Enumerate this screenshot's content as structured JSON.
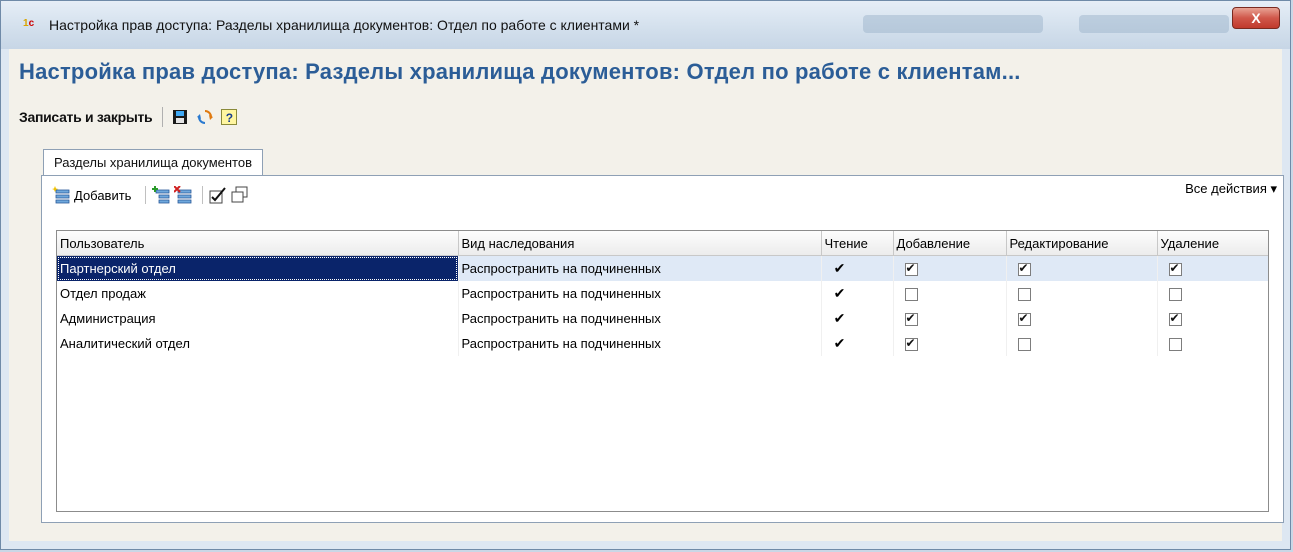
{
  "window": {
    "title": "Настройка прав доступа: Разделы хранилища документов: Отдел по работе с клиентами *",
    "close_label": "X"
  },
  "form": {
    "title": "Настройка прав доступа: Разделы хранилища документов: Отдел по работе с клиентам..."
  },
  "commandbar": {
    "save_close_label": "Записать и закрыть",
    "help_label": "?"
  },
  "tab": {
    "label": "Разделы хранилища документов"
  },
  "toolbar": {
    "add_label": "Добавить",
    "all_actions_label": "Все действия ▾"
  },
  "table": {
    "columns": [
      "Пользователь",
      "Вид наследования",
      "Чтение",
      "Добавление",
      "Редактирование",
      "Удаление"
    ],
    "rows": [
      {
        "user": "Партнерский отдел",
        "inheritance": "Распространить на подчиненных",
        "read": true,
        "add": true,
        "edit": true,
        "delete": true
      },
      {
        "user": "Отдел продаж",
        "inheritance": "Распространить на подчиненных",
        "read": true,
        "add": false,
        "edit": false,
        "delete": false
      },
      {
        "user": "Администрация",
        "inheritance": "Распространить на подчиненных",
        "read": true,
        "add": true,
        "edit": true,
        "delete": true
      },
      {
        "user": "Аналитический отдел",
        "inheritance": "Распространить на подчиненных",
        "read": true,
        "add": true,
        "edit": false,
        "delete": false
      }
    ],
    "selected_row": 0
  },
  "colors": {
    "title_blue": "#2b5d97",
    "selection": "#0a246a",
    "row_highlight": "#dfe9f6"
  }
}
